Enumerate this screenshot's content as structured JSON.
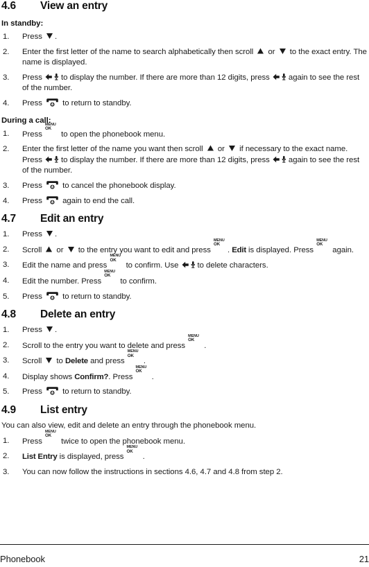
{
  "document": {
    "footer": {
      "chapter": "Phonebook",
      "page_number": "21"
    }
  },
  "icons": {
    "scroll_up": "triangle-up-icon",
    "scroll_down": "triangle-down-icon",
    "back_mute": "back-mute-key-icon",
    "menu_ok": "menu-ok-key-icon",
    "end_call": "end-call-key-icon",
    "menu_label": "MENU",
    "ok_label": "OK"
  },
  "sections": [
    {
      "number": "4.6",
      "title": "View an entry",
      "groups": [
        {
          "label": "In standby:",
          "steps": [
            {
              "marker": "1.",
              "parts": [
                {
                  "t": "text",
                  "v": "Press "
                },
                {
                  "t": "icon",
                  "v": "scroll_down"
                },
                {
                  "t": "text",
                  "v": "."
                }
              ]
            },
            {
              "marker": "2.",
              "parts": [
                {
                  "t": "text",
                  "v": "Enter the first letter of the name to search alphabetically then scroll "
                },
                {
                  "t": "icon",
                  "v": "scroll_up"
                },
                {
                  "t": "text",
                  "v": " or "
                },
                {
                  "t": "icon",
                  "v": "scroll_down"
                },
                {
                  "t": "text",
                  "v": " to the exact entry. The name is displayed."
                }
              ]
            },
            {
              "marker": "3.",
              "parts": [
                {
                  "t": "text",
                  "v": "Press "
                },
                {
                  "t": "icon",
                  "v": "back_mute"
                },
                {
                  "t": "text",
                  "v": "to display the number. If there are more than 12 digits, press "
                },
                {
                  "t": "icon",
                  "v": "back_mute"
                },
                {
                  "t": "text",
                  "v": "again to see the rest of the number."
                }
              ]
            },
            {
              "marker": "4.",
              "parts": [
                {
                  "t": "text",
                  "v": "Press "
                },
                {
                  "t": "icon",
                  "v": "end_call"
                },
                {
                  "t": "text",
                  "v": " to return to standby."
                }
              ]
            }
          ]
        },
        {
          "label": "During a call:",
          "steps": [
            {
              "marker": "1.",
              "parts": [
                {
                  "t": "text",
                  "v": "Press "
                },
                {
                  "t": "icon",
                  "v": "menu_ok"
                },
                {
                  "t": "text",
                  "v": " to open the phonebook menu."
                }
              ]
            },
            {
              "marker": "2.",
              "parts": [
                {
                  "t": "text",
                  "v": "Enter the first letter of the name you want then scroll "
                },
                {
                  "t": "icon",
                  "v": "scroll_up"
                },
                {
                  "t": "text",
                  "v": " or "
                },
                {
                  "t": "icon",
                  "v": "scroll_down"
                },
                {
                  "t": "text",
                  "v": " if necessary to the exact name. Press "
                },
                {
                  "t": "icon",
                  "v": "back_mute"
                },
                {
                  "t": "text",
                  "v": "to display the number. If there are more than 12 digits, press "
                },
                {
                  "t": "icon",
                  "v": "back_mute"
                },
                {
                  "t": "text",
                  "v": "again to see the rest of the number."
                }
              ]
            },
            {
              "marker": "3.",
              "parts": [
                {
                  "t": "text",
                  "v": "Press "
                },
                {
                  "t": "icon",
                  "v": "end_call"
                },
                {
                  "t": "text",
                  "v": " to cancel the phonebook display."
                }
              ]
            },
            {
              "marker": "4.",
              "parts": [
                {
                  "t": "text",
                  "v": "Press "
                },
                {
                  "t": "icon",
                  "v": "end_call"
                },
                {
                  "t": "text",
                  "v": " again to end the call."
                }
              ]
            }
          ]
        }
      ]
    },
    {
      "number": "4.7",
      "title": "Edit an entry",
      "groups": [
        {
          "label": null,
          "steps": [
            {
              "marker": "1.",
              "parts": [
                {
                  "t": "text",
                  "v": "Press "
                },
                {
                  "t": "icon",
                  "v": "scroll_down"
                },
                {
                  "t": "text",
                  "v": "."
                }
              ]
            },
            {
              "marker": "2.",
              "parts": [
                {
                  "t": "text",
                  "v": "Scroll "
                },
                {
                  "t": "icon",
                  "v": "scroll_up"
                },
                {
                  "t": "text",
                  "v": " or "
                },
                {
                  "t": "icon",
                  "v": "scroll_down"
                },
                {
                  "t": "text",
                  "v": " to the entry you want to edit and press "
                },
                {
                  "t": "icon",
                  "v": "menu_ok"
                },
                {
                  "t": "text",
                  "v": ". "
                },
                {
                  "t": "disp",
                  "v": "Edit"
                },
                {
                  "t": "text",
                  "v": " is displayed. Press "
                },
                {
                  "t": "icon",
                  "v": "menu_ok"
                },
                {
                  "t": "text",
                  "v": " again."
                }
              ]
            },
            {
              "marker": "3.",
              "parts": [
                {
                  "t": "text",
                  "v": "Edit the name and press "
                },
                {
                  "t": "icon",
                  "v": "menu_ok"
                },
                {
                  "t": "text",
                  "v": " to confirm. Use "
                },
                {
                  "t": "icon",
                  "v": "back_mute"
                },
                {
                  "t": "text",
                  "v": "to delete characters."
                }
              ]
            },
            {
              "marker": "4.",
              "parts": [
                {
                  "t": "text",
                  "v": "Edit the number. Press "
                },
                {
                  "t": "icon",
                  "v": "menu_ok"
                },
                {
                  "t": "text",
                  "v": " to confirm."
                }
              ]
            },
            {
              "marker": "5.",
              "parts": [
                {
                  "t": "text",
                  "v": "Press "
                },
                {
                  "t": "icon",
                  "v": "end_call"
                },
                {
                  "t": "text",
                  "v": " to return to standby."
                }
              ]
            }
          ]
        }
      ]
    },
    {
      "number": "4.8",
      "title": "Delete an entry",
      "groups": [
        {
          "label": null,
          "steps": [
            {
              "marker": "1.",
              "parts": [
                {
                  "t": "text",
                  "v": "Press "
                },
                {
                  "t": "icon",
                  "v": "scroll_down"
                },
                {
                  "t": "text",
                  "v": "."
                }
              ]
            },
            {
              "marker": "2.",
              "parts": [
                {
                  "t": "text",
                  "v": "Scroll to the entry you want to delete and press "
                },
                {
                  "t": "icon",
                  "v": "menu_ok"
                },
                {
                  "t": "text",
                  "v": " ."
                }
              ]
            },
            {
              "marker": "3.",
              "parts": [
                {
                  "t": "text",
                  "v": "Scroll "
                },
                {
                  "t": "icon",
                  "v": "scroll_down"
                },
                {
                  "t": "text",
                  "v": " to "
                },
                {
                  "t": "disp",
                  "v": "Delete"
                },
                {
                  "t": "text",
                  "v": " and press "
                },
                {
                  "t": "icon",
                  "v": "menu_ok"
                },
                {
                  "t": "text",
                  "v": " ."
                }
              ]
            },
            {
              "marker": "4.",
              "parts": [
                {
                  "t": "text",
                  "v": "Display shows "
                },
                {
                  "t": "disp",
                  "v": "Confirm?"
                },
                {
                  "t": "text",
                  "v": ". Press "
                },
                {
                  "t": "icon",
                  "v": "menu_ok"
                },
                {
                  "t": "text",
                  "v": " ."
                }
              ]
            },
            {
              "marker": "5.",
              "parts": [
                {
                  "t": "text",
                  "v": "Press "
                },
                {
                  "t": "icon",
                  "v": "end_call"
                },
                {
                  "t": "text",
                  "v": " to return to standby."
                }
              ]
            }
          ]
        }
      ]
    },
    {
      "number": "4.9",
      "title": "List entry",
      "intro": "You can also view, edit and delete an entry through the phonebook menu.",
      "groups": [
        {
          "label": null,
          "steps": [
            {
              "marker": "1.",
              "parts": [
                {
                  "t": "text",
                  "v": "Press "
                },
                {
                  "t": "icon",
                  "v": "menu_ok"
                },
                {
                  "t": "text",
                  "v": " twice to open the phonebook menu."
                }
              ]
            },
            {
              "marker": "2.",
              "parts": [
                {
                  "t": "disp",
                  "v": "List Entry"
                },
                {
                  "t": "text",
                  "v": " is displayed, press "
                },
                {
                  "t": "icon",
                  "v": "menu_ok"
                },
                {
                  "t": "text",
                  "v": " ."
                }
              ]
            },
            {
              "marker": "3.",
              "parts": [
                {
                  "t": "text",
                  "v": "You can now follow the instructions in sections 4.6, 4.7 and 4.8 from step 2."
                }
              ]
            }
          ]
        }
      ]
    }
  ]
}
